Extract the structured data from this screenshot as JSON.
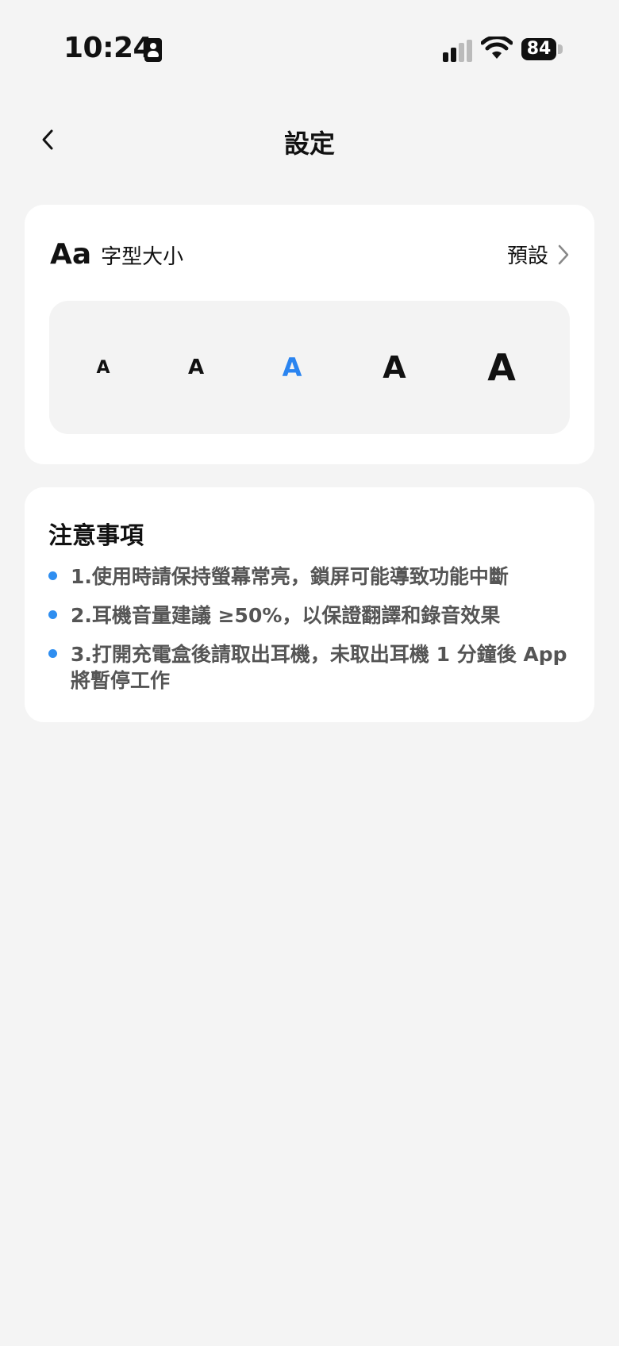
{
  "status_bar": {
    "time": "10:24",
    "battery": "84"
  },
  "nav": {
    "title": "設定"
  },
  "font_size_card": {
    "aa_icon": "Aa",
    "label": "字型大小",
    "default_label": "預設",
    "options": [
      {
        "glyph": "A",
        "size_level": 1,
        "selected": false
      },
      {
        "glyph": "A",
        "size_level": 2,
        "selected": false
      },
      {
        "glyph": "A",
        "size_level": 3,
        "selected": true
      },
      {
        "glyph": "A",
        "size_level": 4,
        "selected": false
      },
      {
        "glyph": "A",
        "size_level": 5,
        "selected": false
      }
    ],
    "selected_color": "#2a84f0"
  },
  "notes_card": {
    "title": "注意事項",
    "items": [
      "1.使用時請保持螢幕常亮，鎖屏可能導致功能中斷",
      "2.耳機音量建議 ≥50%，以保證翻譯和錄音效果",
      "3.打開充電盒後請取出耳機，未取出耳機 1 分鐘後 App 將暫停工作"
    ],
    "bullet_color": "#2f8ef0"
  }
}
